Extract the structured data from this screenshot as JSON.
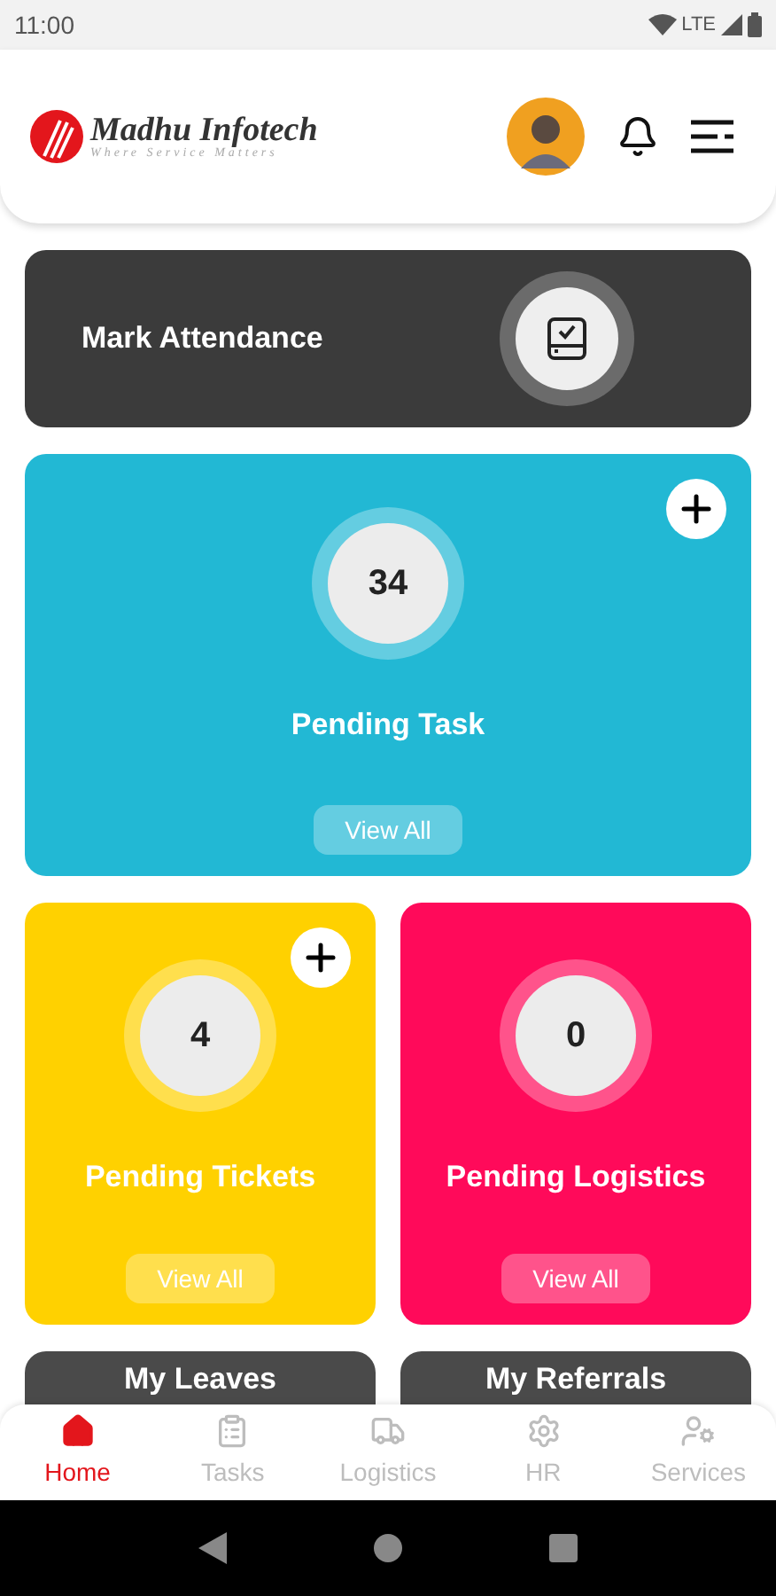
{
  "status_bar": {
    "time": "11:00",
    "network": "LTE"
  },
  "header": {
    "brand": "Madhu Infotech",
    "tagline": "Where Service Matters"
  },
  "attendance": {
    "label": "Mark Attendance"
  },
  "cards": [
    {
      "kind": "wide",
      "title": "Pending Task",
      "count": "34",
      "button": "View All",
      "color": "#22b8d4",
      "has_add": true
    },
    {
      "kind": "half",
      "title": "Pending Tickets",
      "count": "4",
      "button": "View All",
      "color": "#ffd100",
      "has_add": true
    },
    {
      "kind": "half",
      "title": "Pending Logistics",
      "count": "0",
      "button": "View All",
      "color": "#ff0a5a",
      "has_add": false
    }
  ],
  "more_cards": [
    {
      "title": "My Leaves"
    },
    {
      "title": "My Referrals"
    }
  ],
  "bottom_nav": [
    {
      "label": "Home",
      "selected": true
    },
    {
      "label": "Tasks",
      "selected": false
    },
    {
      "label": "Logistics",
      "selected": false
    },
    {
      "label": "HR",
      "selected": false
    },
    {
      "label": "Services",
      "selected": false
    }
  ]
}
